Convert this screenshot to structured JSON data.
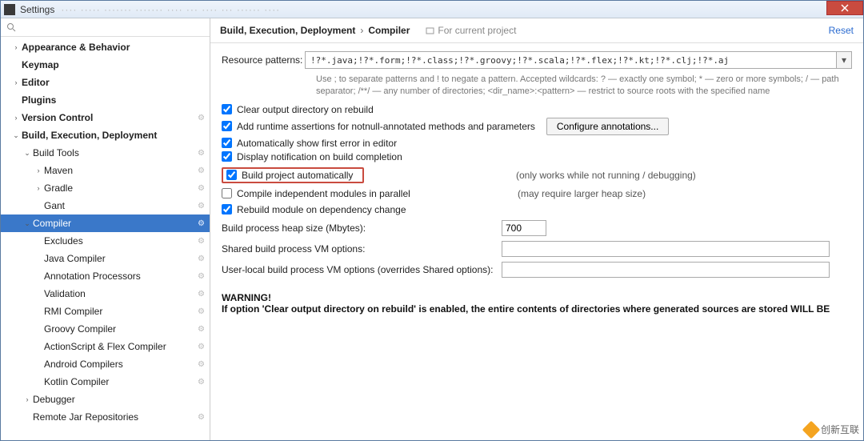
{
  "titlebar": {
    "title": "Settings",
    "menu_blur": "····  ·····  ·······  ·······  ····  ···  ····  ···  ······  ····"
  },
  "search": {
    "placeholder": ""
  },
  "sidebar": {
    "items": [
      {
        "label": "Appearance & Behavior",
        "bold": true,
        "arrow": "›",
        "pad": 1
      },
      {
        "label": "Keymap",
        "bold": true,
        "arrow": "",
        "pad": 1
      },
      {
        "label": "Editor",
        "bold": true,
        "arrow": "›",
        "pad": 1
      },
      {
        "label": "Plugins",
        "bold": true,
        "arrow": "",
        "pad": 1
      },
      {
        "label": "Version Control",
        "bold": true,
        "arrow": "›",
        "pad": 1,
        "gear": true
      },
      {
        "label": "Build, Execution, Deployment",
        "bold": true,
        "arrow": "⌄",
        "pad": 1
      },
      {
        "label": "Build Tools",
        "bold": false,
        "arrow": "⌄",
        "pad": 2,
        "gear": true
      },
      {
        "label": "Maven",
        "bold": false,
        "arrow": "›",
        "pad": 3,
        "gear": true
      },
      {
        "label": "Gradle",
        "bold": false,
        "arrow": "›",
        "pad": 3,
        "gear": true
      },
      {
        "label": "Gant",
        "bold": false,
        "arrow": "",
        "pad": 3,
        "gear": true
      },
      {
        "label": "Compiler",
        "bold": false,
        "arrow": "⌄",
        "pad": 2,
        "gear": true,
        "selected": true
      },
      {
        "label": "Excludes",
        "bold": false,
        "arrow": "",
        "pad": 3,
        "gear": true
      },
      {
        "label": "Java Compiler",
        "bold": false,
        "arrow": "",
        "pad": 3,
        "gear": true
      },
      {
        "label": "Annotation Processors",
        "bold": false,
        "arrow": "",
        "pad": 3,
        "gear": true
      },
      {
        "label": "Validation",
        "bold": false,
        "arrow": "",
        "pad": 3,
        "gear": true
      },
      {
        "label": "RMI Compiler",
        "bold": false,
        "arrow": "",
        "pad": 3,
        "gear": true
      },
      {
        "label": "Groovy Compiler",
        "bold": false,
        "arrow": "",
        "pad": 3,
        "gear": true
      },
      {
        "label": "ActionScript & Flex Compiler",
        "bold": false,
        "arrow": "",
        "pad": 3,
        "gear": true
      },
      {
        "label": "Android Compilers",
        "bold": false,
        "arrow": "",
        "pad": 3,
        "gear": true
      },
      {
        "label": "Kotlin Compiler",
        "bold": false,
        "arrow": "",
        "pad": 3,
        "gear": true
      },
      {
        "label": "Debugger",
        "bold": false,
        "arrow": "›",
        "pad": 2
      },
      {
        "label": "Remote Jar Repositories",
        "bold": false,
        "arrow": "",
        "pad": 2,
        "gear": true
      }
    ]
  },
  "crumbs": {
    "a": "Build, Execution, Deployment",
    "b": "Compiler",
    "project": "For current project",
    "reset": "Reset"
  },
  "form": {
    "patterns_label": "Resource patterns:",
    "patterns_value": "!?*.java;!?*.form;!?*.class;!?*.groovy;!?*.scala;!?*.flex;!?*.kt;!?*.clj;!?*.aj",
    "patterns_hint": "Use ; to separate patterns and ! to negate a pattern. Accepted wildcards: ? — exactly one symbol; * — zero or more symbols; / — path separator; /**/ — any number of directories; <dir_name>:<pattern> — restrict to source roots with the specified name",
    "chk_clear": "Clear output directory on rebuild",
    "chk_runtime": "Add runtime assertions for notnull-annotated methods and parameters",
    "btn_configure": "Configure annotations...",
    "chk_autoerr": "Automatically show first error in editor",
    "chk_notify": "Display notification on build completion",
    "chk_autobuild": "Build project automatically",
    "chk_autobuild_side": "(only works while not running / debugging)",
    "chk_parallel": "Compile independent modules in parallel",
    "chk_parallel_side": "(may require larger heap size)",
    "chk_rebuild": "Rebuild module on dependency change",
    "heap_label": "Build process heap size (Mbytes):",
    "heap_value": "700",
    "shared_label": "Shared build process VM options:",
    "userlocal_label": "User-local build process VM options (overrides Shared options):",
    "warn_title": "WARNING!",
    "warn_text": "If option 'Clear output directory on rebuild' is enabled, the entire contents of directories where generated sources are stored WILL BE"
  },
  "watermark": "创新互联"
}
